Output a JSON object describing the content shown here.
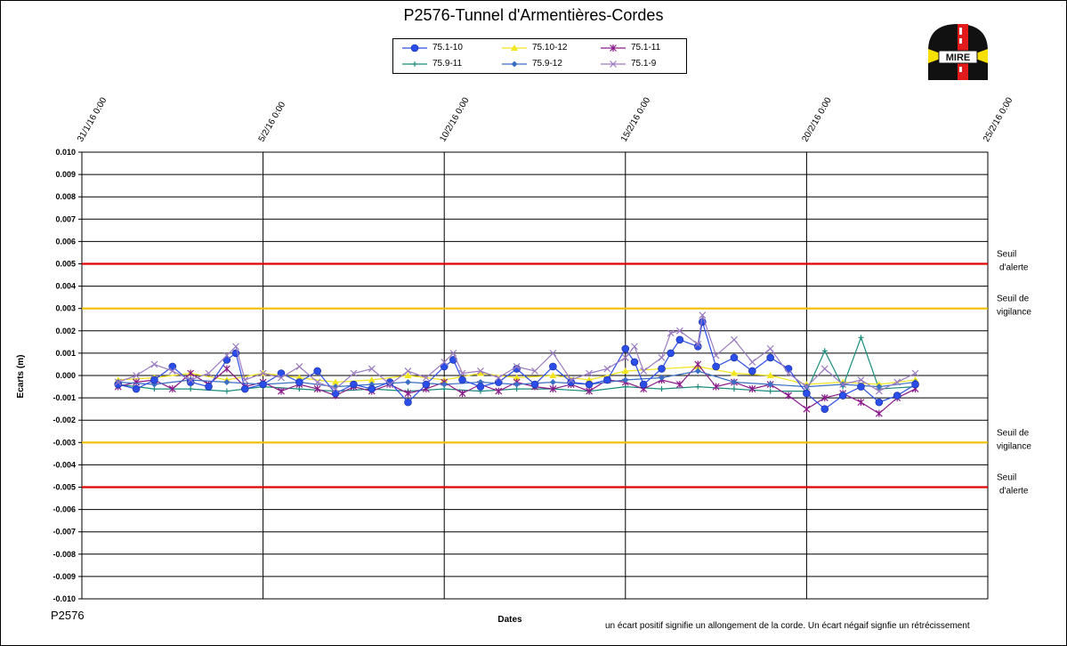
{
  "chart_data": {
    "type": "line",
    "title": "P2576-Tunnel  d'Armentières-Cordes",
    "xlabel": "Dates",
    "ylabel": "Ecarts (m)",
    "x_ticks": [
      "31/1/16 0:00",
      "5/2/16 0:00",
      "10/2/16 0:00",
      "15/2/16 0:00",
      "20/2/16 0:00",
      "25/2/16 0:00"
    ],
    "xlim": [
      "2016-01-31",
      "2016-02-25"
    ],
    "y_ticks": [
      "0.010",
      "0.009",
      "0.008",
      "0.007",
      "0.006",
      "0.005",
      "0.004",
      "0.003",
      "0.002",
      "0.001",
      "0.000",
      "-0.001",
      "-0.002",
      "-0.003",
      "-0.004",
      "-0.005",
      "-0.006",
      "-0.007",
      "-0.008",
      "-0.009",
      "-0.010"
    ],
    "ylim": [
      -0.01,
      0.01
    ],
    "grid": true,
    "legend_position": "top-center",
    "thresholds": [
      {
        "value": 0.005,
        "color": "#e00000",
        "label": [
          "Seuil",
          "d'alerte"
        ]
      },
      {
        "value": 0.003,
        "color": "#f0c000",
        "label": [
          "Seuil de",
          "vigilance"
        ]
      },
      {
        "value": -0.003,
        "color": "#f0c000",
        "label": [
          "Seuil de",
          "vigilance"
        ]
      },
      {
        "value": -0.005,
        "color": "#e00000",
        "label": [
          "Seuil",
          "d'alerte"
        ]
      }
    ],
    "series": [
      {
        "name": "75.1-10",
        "color": "#2a4ee8",
        "marker": "circle",
        "points": [
          [
            "2016-02-01T00:00",
            -0.0004
          ],
          [
            "2016-02-01T12:00",
            -0.0006
          ],
          [
            "2016-02-02T00:00",
            -0.0002
          ],
          [
            "2016-02-02T12:00",
            0.0004
          ],
          [
            "2016-02-03T00:00",
            -0.0003
          ],
          [
            "2016-02-03T12:00",
            -0.0005
          ],
          [
            "2016-02-04T00:00",
            0.0007
          ],
          [
            "2016-02-04T06:00",
            0.001
          ],
          [
            "2016-02-04T12:00",
            -0.0006
          ],
          [
            "2016-02-05T00:00",
            -0.0004
          ],
          [
            "2016-02-05T12:00",
            0.0001
          ],
          [
            "2016-02-06T00:00",
            -0.0003
          ],
          [
            "2016-02-06T12:00",
            0.0002
          ],
          [
            "2016-02-07T00:00",
            -0.0008
          ],
          [
            "2016-02-07T12:00",
            -0.0004
          ],
          [
            "2016-02-08T00:00",
            -0.0006
          ],
          [
            "2016-02-08T12:00",
            -0.0003
          ],
          [
            "2016-02-09T00:00",
            -0.0012
          ],
          [
            "2016-02-09T12:00",
            -0.0004
          ],
          [
            "2016-02-10T00:00",
            0.0004
          ],
          [
            "2016-02-10T06:00",
            0.0007
          ],
          [
            "2016-02-10T12:00",
            -0.0002
          ],
          [
            "2016-02-11T00:00",
            -0.0005
          ],
          [
            "2016-02-11T12:00",
            -0.0003
          ],
          [
            "2016-02-12T00:00",
            0.0003
          ],
          [
            "2016-02-12T12:00",
            -0.0004
          ],
          [
            "2016-02-13T00:00",
            0.0004
          ],
          [
            "2016-02-13T12:00",
            -0.0003
          ],
          [
            "2016-02-14T00:00",
            -0.0004
          ],
          [
            "2016-02-14T12:00",
            -0.0002
          ],
          [
            "2016-02-15T00:00",
            0.0012
          ],
          [
            "2016-02-15T06:00",
            0.0006
          ],
          [
            "2016-02-15T12:00",
            -0.0004
          ],
          [
            "2016-02-16T00:00",
            0.0003
          ],
          [
            "2016-02-16T06:00",
            0.001
          ],
          [
            "2016-02-16T12:00",
            0.0016
          ],
          [
            "2016-02-17T00:00",
            0.0013
          ],
          [
            "2016-02-17T03:00",
            0.0024
          ],
          [
            "2016-02-17T12:00",
            0.0004
          ],
          [
            "2016-02-18T00:00",
            0.0008
          ],
          [
            "2016-02-18T12:00",
            0.0002
          ],
          [
            "2016-02-19T00:00",
            0.0008
          ],
          [
            "2016-02-19T12:00",
            0.0003
          ],
          [
            "2016-02-20T00:00",
            -0.0008
          ],
          [
            "2016-02-20T12:00",
            -0.0015
          ],
          [
            "2016-02-21T00:00",
            -0.0009
          ],
          [
            "2016-02-21T12:00",
            -0.0005
          ],
          [
            "2016-02-22T00:00",
            -0.0012
          ],
          [
            "2016-02-22T12:00",
            -0.0009
          ],
          [
            "2016-02-23T00:00",
            -0.0004
          ]
        ]
      },
      {
        "name": "75.10-12",
        "color": "#f2e51b",
        "marker": "triangle",
        "points": [
          [
            "2016-02-01T00:00",
            -0.0002
          ],
          [
            "2016-02-02T00:00",
            -0.0001
          ],
          [
            "2016-02-03T00:00",
            0.0001
          ],
          [
            "2016-02-04T00:00",
            -0.0002
          ],
          [
            "2016-02-05T00:00",
            0.0001
          ],
          [
            "2016-02-06T00:00",
            -0.0001
          ],
          [
            "2016-02-07T00:00",
            -0.0003
          ],
          [
            "2016-02-08T00:00",
            -0.0002
          ],
          [
            "2016-02-09T00:00",
            0.0
          ],
          [
            "2016-02-10T00:00",
            -0.0002
          ],
          [
            "2016-02-11T00:00",
            0.0001
          ],
          [
            "2016-02-12T00:00",
            -0.0001
          ],
          [
            "2016-02-13T00:00",
            0.0
          ],
          [
            "2016-02-14T00:00",
            -0.0002
          ],
          [
            "2016-02-15T00:00",
            0.0002
          ],
          [
            "2016-02-16T00:00",
            0.0003
          ],
          [
            "2016-02-17T00:00",
            0.0004
          ],
          [
            "2016-02-18T00:00",
            0.0001
          ],
          [
            "2016-02-19T00:00",
            0.0
          ],
          [
            "2016-02-20T00:00",
            -0.0004
          ],
          [
            "2016-02-21T00:00",
            -0.0003
          ],
          [
            "2016-02-22T00:00",
            -0.0004
          ],
          [
            "2016-02-23T00:00",
            -0.0002
          ]
        ]
      },
      {
        "name": "75.1-11",
        "color": "#8a1a8a",
        "marker": "star",
        "points": [
          [
            "2016-02-01T00:00",
            -0.0005
          ],
          [
            "2016-02-01T12:00",
            -0.0003
          ],
          [
            "2016-02-02T00:00",
            -0.0002
          ],
          [
            "2016-02-02T12:00",
            -0.0006
          ],
          [
            "2016-02-03T00:00",
            0.0001
          ],
          [
            "2016-02-03T12:00",
            -0.0004
          ],
          [
            "2016-02-04T00:00",
            0.0003
          ],
          [
            "2016-02-04T12:00",
            -0.0005
          ],
          [
            "2016-02-05T00:00",
            -0.0003
          ],
          [
            "2016-02-05T12:00",
            -0.0007
          ],
          [
            "2016-02-06T00:00",
            -0.0004
          ],
          [
            "2016-02-06T12:00",
            -0.0006
          ],
          [
            "2016-02-07T00:00",
            -0.0009
          ],
          [
            "2016-02-07T12:00",
            -0.0005
          ],
          [
            "2016-02-08T00:00",
            -0.0007
          ],
          [
            "2016-02-08T12:00",
            -0.0004
          ],
          [
            "2016-02-09T00:00",
            -0.0008
          ],
          [
            "2016-02-09T12:00",
            -0.0006
          ],
          [
            "2016-02-10T00:00",
            -0.0003
          ],
          [
            "2016-02-10T12:00",
            -0.0008
          ],
          [
            "2016-02-11T00:00",
            -0.0004
          ],
          [
            "2016-02-11T12:00",
            -0.0007
          ],
          [
            "2016-02-12T00:00",
            -0.0003
          ],
          [
            "2016-02-12T12:00",
            -0.0005
          ],
          [
            "2016-02-13T00:00",
            -0.0006
          ],
          [
            "2016-02-13T12:00",
            -0.0004
          ],
          [
            "2016-02-14T00:00",
            -0.0007
          ],
          [
            "2016-02-14T12:00",
            -0.0002
          ],
          [
            "2016-02-15T00:00",
            -0.0003
          ],
          [
            "2016-02-15T12:00",
            -0.0006
          ],
          [
            "2016-02-16T00:00",
            -0.0002
          ],
          [
            "2016-02-16T12:00",
            -0.0004
          ],
          [
            "2016-02-17T00:00",
            0.0005
          ],
          [
            "2016-02-17T12:00",
            -0.0005
          ],
          [
            "2016-02-18T00:00",
            -0.0003
          ],
          [
            "2016-02-18T12:00",
            -0.0006
          ],
          [
            "2016-02-19T00:00",
            -0.0004
          ],
          [
            "2016-02-19T12:00",
            -0.0009
          ],
          [
            "2016-02-20T00:00",
            -0.0015
          ],
          [
            "2016-02-20T12:00",
            -0.001
          ],
          [
            "2016-02-21T00:00",
            -0.0008
          ],
          [
            "2016-02-21T12:00",
            -0.0012
          ],
          [
            "2016-02-22T00:00",
            -0.0017
          ],
          [
            "2016-02-22T12:00",
            -0.001
          ],
          [
            "2016-02-23T00:00",
            -0.0006
          ]
        ]
      },
      {
        "name": "75.9-11",
        "color": "#1a8c7a",
        "marker": "plus",
        "points": [
          [
            "2016-02-01T00:00",
            -0.0004
          ],
          [
            "2016-02-02T00:00",
            -0.0006
          ],
          [
            "2016-02-03T00:00",
            -0.0006
          ],
          [
            "2016-02-04T00:00",
            -0.0007
          ],
          [
            "2016-02-05T00:00",
            -0.0005
          ],
          [
            "2016-02-06T00:00",
            -0.0006
          ],
          [
            "2016-02-07T00:00",
            -0.0007
          ],
          [
            "2016-02-08T00:00",
            -0.0006
          ],
          [
            "2016-02-09T00:00",
            -0.0007
          ],
          [
            "2016-02-10T00:00",
            -0.0006
          ],
          [
            "2016-02-11T00:00",
            -0.0007
          ],
          [
            "2016-02-12T00:00",
            -0.0006
          ],
          [
            "2016-02-13T00:00",
            -0.0006
          ],
          [
            "2016-02-14T00:00",
            -0.0007
          ],
          [
            "2016-02-15T00:00",
            -0.0005
          ],
          [
            "2016-02-16T00:00",
            -0.0006
          ],
          [
            "2016-02-17T00:00",
            -0.0005
          ],
          [
            "2016-02-18T00:00",
            -0.0006
          ],
          [
            "2016-02-19T00:00",
            -0.0007
          ],
          [
            "2016-02-20T00:00",
            -0.0007
          ],
          [
            "2016-02-20T12:00",
            0.0011
          ],
          [
            "2016-02-21T00:00",
            -0.0005
          ],
          [
            "2016-02-21T12:00",
            0.0017
          ],
          [
            "2016-02-22T00:00",
            -0.0006
          ],
          [
            "2016-02-23T00:00",
            -0.0005
          ]
        ]
      },
      {
        "name": "75.9-12",
        "color": "#3b6ec4",
        "marker": "diamond",
        "points": [
          [
            "2016-02-01T00:00",
            -0.0003
          ],
          [
            "2016-02-02T00:00",
            -0.0004
          ],
          [
            "2016-02-03T00:00",
            -0.0002
          ],
          [
            "2016-02-04T00:00",
            -0.0003
          ],
          [
            "2016-02-05T00:00",
            -0.0004
          ],
          [
            "2016-02-06T00:00",
            -0.0003
          ],
          [
            "2016-02-07T00:00",
            -0.0005
          ],
          [
            "2016-02-08T00:00",
            -0.0004
          ],
          [
            "2016-02-09T00:00",
            -0.0003
          ],
          [
            "2016-02-10T00:00",
            -0.0004
          ],
          [
            "2016-02-11T00:00",
            -0.0003
          ],
          [
            "2016-02-12T00:00",
            -0.0004
          ],
          [
            "2016-02-13T00:00",
            -0.0003
          ],
          [
            "2016-02-14T00:00",
            -0.0004
          ],
          [
            "2016-02-15T00:00",
            -0.0002
          ],
          [
            "2016-02-16T00:00",
            -0.0001
          ],
          [
            "2016-02-17T00:00",
            0.0002
          ],
          [
            "2016-02-18T00:00",
            -0.0003
          ],
          [
            "2016-02-19T00:00",
            -0.0004
          ],
          [
            "2016-02-20T00:00",
            -0.0005
          ],
          [
            "2016-02-21T00:00",
            -0.0004
          ],
          [
            "2016-02-22T00:00",
            -0.0005
          ],
          [
            "2016-02-23T00:00",
            -0.0003
          ]
        ]
      },
      {
        "name": "75.1-9",
        "color": "#9a7abf",
        "marker": "x",
        "points": [
          [
            "2016-02-01T00:00",
            -0.0003
          ],
          [
            "2016-02-01T12:00",
            0.0
          ],
          [
            "2016-02-02T00:00",
            0.0005
          ],
          [
            "2016-02-02T12:00",
            0.0002
          ],
          [
            "2016-02-03T00:00",
            -0.0002
          ],
          [
            "2016-02-03T12:00",
            0.0001
          ],
          [
            "2016-02-04T00:00",
            0.0009
          ],
          [
            "2016-02-04T06:00",
            0.0013
          ],
          [
            "2016-02-04T12:00",
            -0.0002
          ],
          [
            "2016-02-05T00:00",
            0.0001
          ],
          [
            "2016-02-05T12:00",
            -0.0001
          ],
          [
            "2016-02-06T00:00",
            0.0004
          ],
          [
            "2016-02-06T12:00",
            -0.0003
          ],
          [
            "2016-02-07T00:00",
            -0.0006
          ],
          [
            "2016-02-07T12:00",
            0.0001
          ],
          [
            "2016-02-08T00:00",
            0.0003
          ],
          [
            "2016-02-08T12:00",
            -0.0004
          ],
          [
            "2016-02-09T00:00",
            0.0002
          ],
          [
            "2016-02-09T12:00",
            -0.0001
          ],
          [
            "2016-02-10T00:00",
            0.0006
          ],
          [
            "2016-02-10T06:00",
            0.001
          ],
          [
            "2016-02-10T12:00",
            0.0001
          ],
          [
            "2016-02-11T00:00",
            0.0002
          ],
          [
            "2016-02-11T12:00",
            -0.0001
          ],
          [
            "2016-02-12T00:00",
            0.0004
          ],
          [
            "2016-02-12T12:00",
            0.0002
          ],
          [
            "2016-02-13T00:00",
            0.001
          ],
          [
            "2016-02-13T12:00",
            -0.0002
          ],
          [
            "2016-02-14T00:00",
            0.0001
          ],
          [
            "2016-02-14T12:00",
            0.0003
          ],
          [
            "2016-02-15T00:00",
            0.0008
          ],
          [
            "2016-02-15T06:00",
            0.0013
          ],
          [
            "2016-02-15T12:00",
            0.0002
          ],
          [
            "2016-02-16T00:00",
            0.0008
          ],
          [
            "2016-02-16T06:00",
            0.0019
          ],
          [
            "2016-02-16T12:00",
            0.002
          ],
          [
            "2016-02-17T00:00",
            0.0014
          ],
          [
            "2016-02-17T03:00",
            0.0027
          ],
          [
            "2016-02-17T12:00",
            0.0009
          ],
          [
            "2016-02-18T00:00",
            0.0016
          ],
          [
            "2016-02-18T12:00",
            0.0006
          ],
          [
            "2016-02-19T00:00",
            0.0012
          ],
          [
            "2016-02-19T12:00",
            0.0001
          ],
          [
            "2016-02-20T00:00",
            -0.0005
          ],
          [
            "2016-02-20T12:00",
            0.0003
          ],
          [
            "2016-02-21T00:00",
            -0.0004
          ],
          [
            "2016-02-21T12:00",
            -0.0002
          ],
          [
            "2016-02-22T00:00",
            -0.0007
          ],
          [
            "2016-02-22T12:00",
            -0.0003
          ],
          [
            "2016-02-23T00:00",
            0.0001
          ]
        ]
      }
    ]
  },
  "labels": {
    "corner_id": "P2576",
    "footnote": "un écart  positif  signifie  un allongement  de la corde.  Un écart négaif  signfie  un rétrécissement",
    "logo_text": "MIRE"
  }
}
